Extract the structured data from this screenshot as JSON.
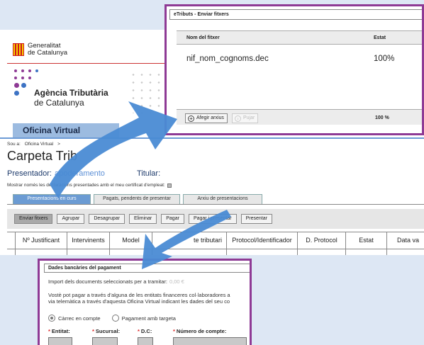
{
  "header": {
    "gencat_line1": "Generalitat",
    "gencat_line2": "de Catalunya",
    "agencia_line1": "Agència Tributària",
    "agencia_line2": "de Catalunya",
    "oficina_tab": "Oficina Virtual"
  },
  "breadcrumb": {
    "prefix": "Sou a:",
    "item": "Oficina Virtual",
    "sep": ">"
  },
  "page_title": "Carpeta Trib",
  "presentador": {
    "label": "Presentador:",
    "value": "apoderamento",
    "titular": "Titular:"
  },
  "only_cert_label": "Mostrar només les declaracions presentades amb el meu certificat d'empleat:",
  "tabs": [
    "Presentacions en curs",
    "Pagats, pendents de presentar",
    "Arxiu de presentacions"
  ],
  "buttons": [
    "Enviar fitxers",
    "Agrupar",
    "Desagrupar",
    "Eliminar",
    "Pagar",
    "Pagar i presentar",
    "Presentar"
  ],
  "grid_headers": [
    "Nº Justificant",
    "Intervinents",
    "Model",
    "te tributari",
    "Protocol/Identificador",
    "D. Protocol",
    "Estat",
    "Data va"
  ],
  "upload_popup": {
    "title": "eTributs - Enviar fitxers",
    "col_file": "Nom del fitxer",
    "col_status": "Estat",
    "file_name": "nif_nom_cognoms.dec",
    "file_status": "100%",
    "add_label": "Afegir arxius",
    "upload_label": "Pujar",
    "total": "100 %"
  },
  "payment_popup": {
    "title": "Dades bancàries del pagament",
    "import_label": "Import dels documents seleccionats per a tramitar:",
    "import_value": "0,00 €",
    "text_line1": "Vostè pot pagar a través d'alguna de les entitats financeres col·laboradores a",
    "text_line2": "via telemàtica a través d'aquesta Oficina Virtual indicant les dades del seu co",
    "radio_account": "Càrrec en compte",
    "radio_card": "Pagament amb targeta",
    "field_entitat": "Entitat:",
    "field_sucursal": "Sucursal:",
    "field_dc": "D.C:",
    "field_compte": "Número de compte:"
  },
  "colors": {
    "accent_purple": "#8e3a95",
    "arrow_blue": "#4a8bd4",
    "tab_blue": "#6b9bd3"
  }
}
